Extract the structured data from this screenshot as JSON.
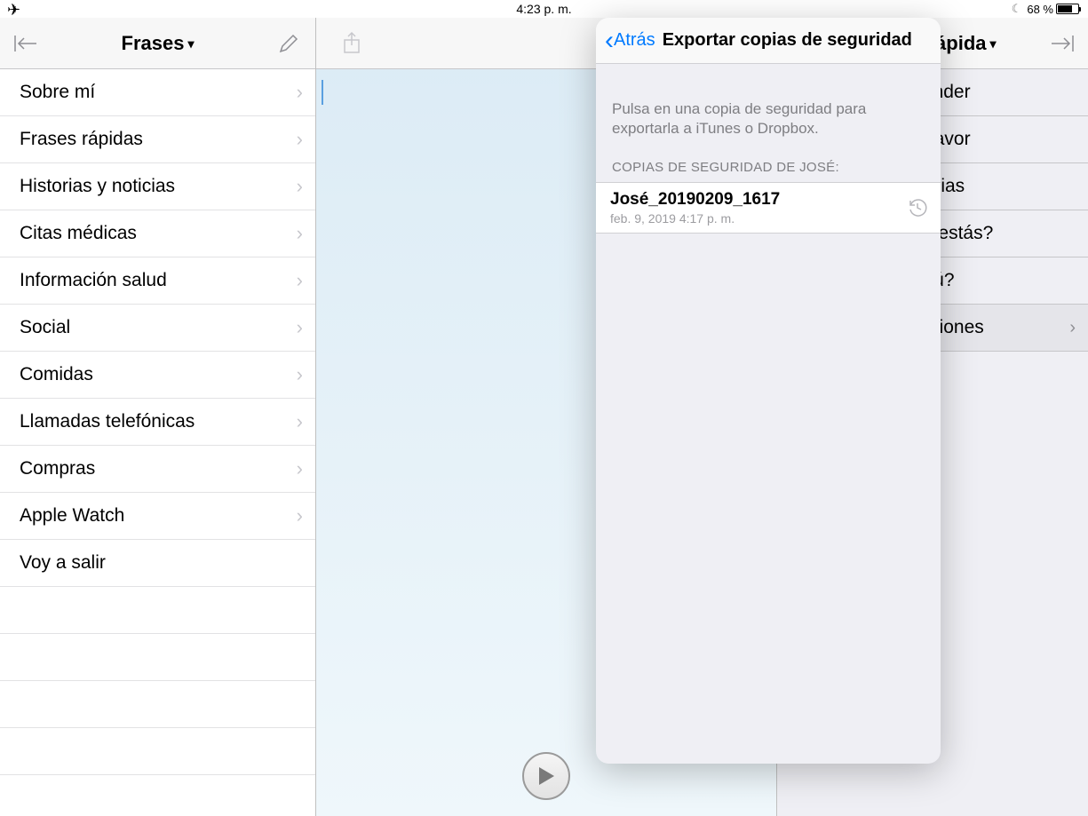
{
  "statusbar": {
    "time": "4:23 p. m.",
    "battery_pct": "68 %"
  },
  "left": {
    "title": "Frases",
    "items": [
      "Sobre mí",
      "Frases rápidas",
      "Historias y noticias",
      "Citas médicas",
      "Información salud",
      "Social",
      "Comidas",
      "Llamadas telefónicas",
      "Compras",
      "Apple Watch",
      "Voy a salir"
    ]
  },
  "right": {
    "title": "Habla rápida",
    "items": [
      "Entender",
      "Por favor",
      "Gracias",
      "¿Cómo estás?",
      "¿Tú?",
      "Expresiones"
    ]
  },
  "popover": {
    "back": "Atrás",
    "title": "Exportar copias de seguridad",
    "hint": "Pulsa en una copia de seguridad para exportarla a iTunes o Dropbox.",
    "section": "COPIAS DE SEGURIDAD DE JOSÉ:",
    "backup": {
      "name": "José_20190209_1617",
      "date": "feb. 9, 2019 4:17 p. m."
    }
  }
}
